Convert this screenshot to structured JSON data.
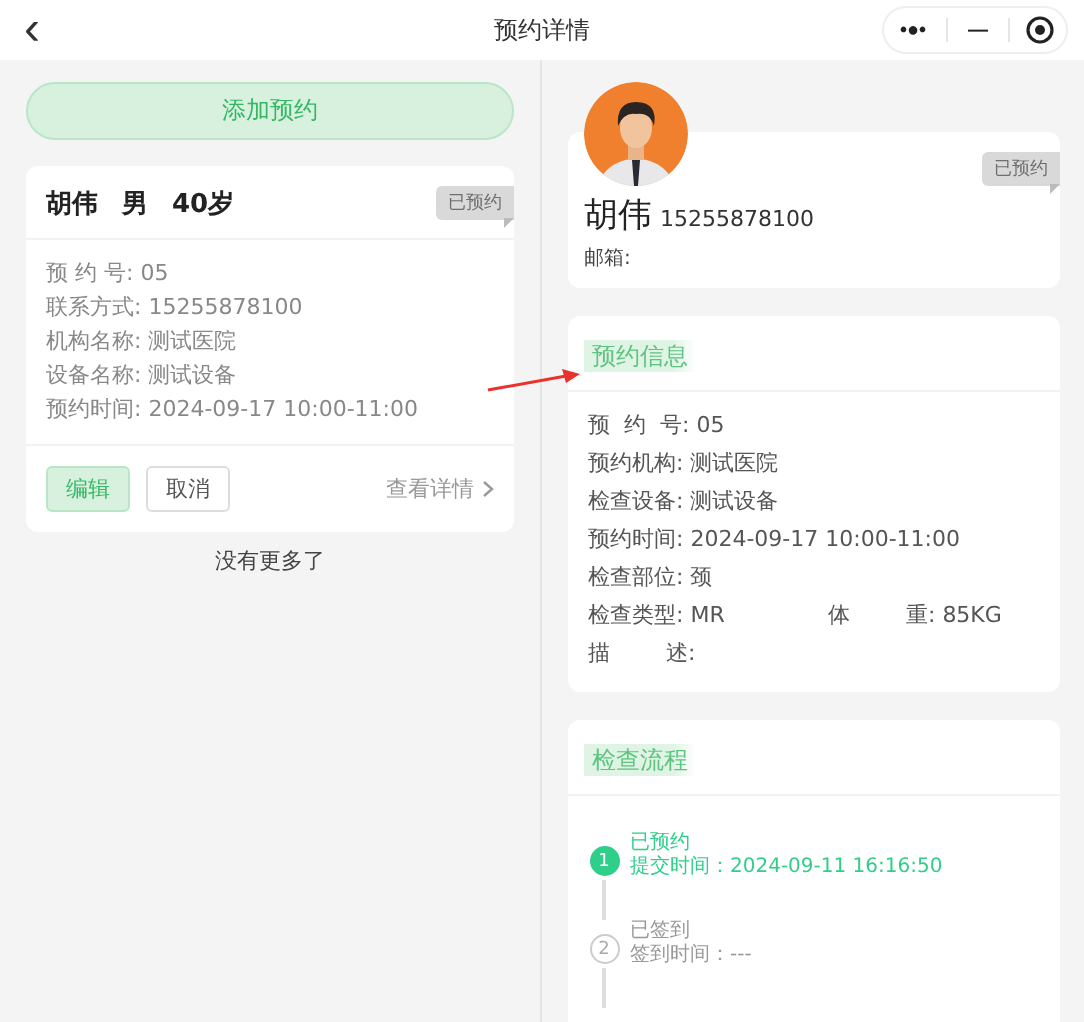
{
  "nav": {
    "back": "‹",
    "title": "预约详情",
    "capsule": {
      "more": "•●•",
      "minimize": "—"
    }
  },
  "left": {
    "add_button": "添加预约",
    "card": {
      "name": "胡伟",
      "gender": "男",
      "age": "40岁",
      "status": {
        "label": "已预约",
        "color": "#d9d9d9"
      },
      "rows": [
        {
          "label": "预 约 号:",
          "value": "05"
        },
        {
          "label": "联系方式:",
          "value": "15255878100"
        },
        {
          "label": "机构名称:",
          "value": "测试医院"
        },
        {
          "label": "设备名称:",
          "value": "测试设备"
        },
        {
          "label": "预约时间:",
          "value": "2024-09-17 10:00-11:00"
        }
      ],
      "buttons": [
        {
          "label": "编辑",
          "kind": "primary"
        },
        {
          "label": "取消",
          "kind": "plain"
        }
      ],
      "details_link": "查看详情"
    },
    "footer": "没有更多了"
  },
  "right": {
    "profile": {
      "name": "胡伟",
      "phone": "15255878100",
      "email_label": "邮箱:",
      "status": {
        "label": "已预约",
        "color": "#d9d9d9"
      }
    },
    "info": {
      "title": "预约信息",
      "rows": [
        {
          "label": "预  约  号:",
          "value": "05"
        },
        {
          "label": "预约机构:",
          "value": "测试医院"
        },
        {
          "label": "检查设备:",
          "value": "测试设备"
        },
        {
          "label": "预约时间:",
          "value": "2024-09-17 10:00-11:00"
        },
        {
          "label": "检查部位:",
          "value": "颈"
        },
        {
          "label": "检查类型:",
          "value": "MR",
          "extra_label": "体        重:",
          "extra_value": "85KG"
        },
        {
          "label": "描        述:"
        }
      ]
    },
    "process": {
      "title": "检查流程",
      "steps": [
        {
          "number": "1",
          "title": "已预约",
          "detail": "提交时间：2024-09-11 16:16:50",
          "selected": true
        },
        {
          "number": "2",
          "title": "已签到",
          "detail": "签到时间：---",
          "selected": false
        }
      ]
    }
  }
}
